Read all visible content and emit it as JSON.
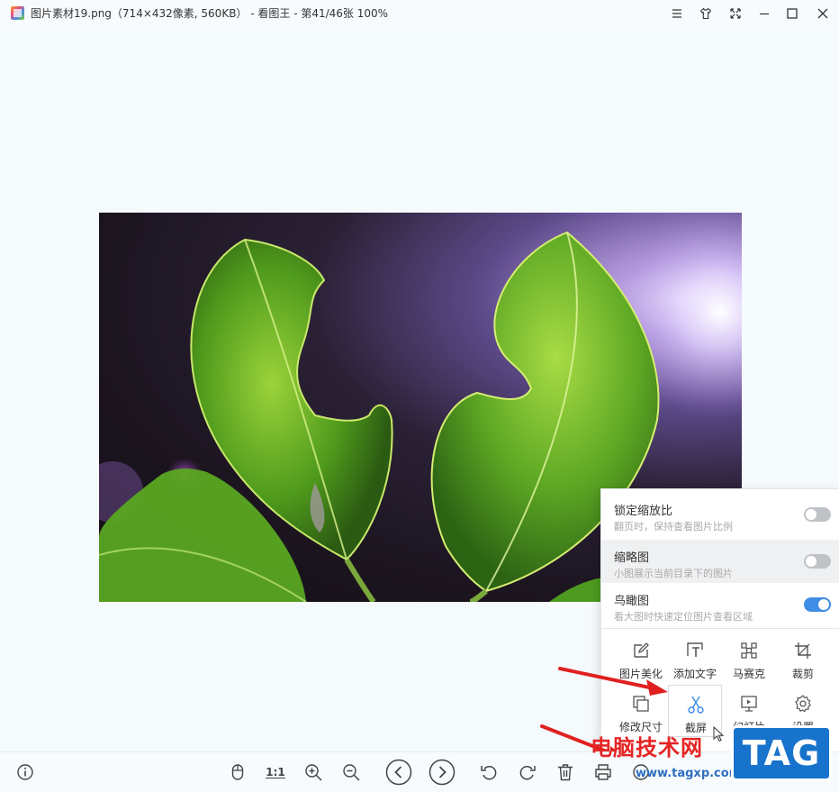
{
  "window": {
    "title": "图片素材19.png（714×432像素, 560KB） - 看图王 - 第41/46张 100%",
    "controls": [
      "menu-icon",
      "skin-icon",
      "fullscreen-icon",
      "minimize-icon",
      "maximize-icon",
      "close-icon"
    ]
  },
  "image": {
    "description_icon": "leaf-photo"
  },
  "settings_panel": {
    "options": [
      {
        "title": "锁定缩放比",
        "desc": "翻页时，保持查看图片比例",
        "enabled": false
      },
      {
        "title": "缩略图",
        "desc": "小图展示当前目录下的图片",
        "enabled": false
      },
      {
        "title": "鸟瞰图",
        "desc": "看大图时快速定位图片查看区域",
        "enabled": true
      }
    ],
    "tools": [
      {
        "label": "图片美化",
        "icon": "edit-icon"
      },
      {
        "label": "添加文字",
        "icon": "add-text-icon"
      },
      {
        "label": "马赛克",
        "icon": "mosaic-icon"
      },
      {
        "label": "裁剪",
        "icon": "crop-icon"
      },
      {
        "label": "修改尺寸",
        "icon": "resize-icon"
      },
      {
        "label": "截屏",
        "icon": "scissors-icon"
      },
      {
        "label": "幻灯片",
        "icon": "slideshow-icon"
      },
      {
        "label": "设置",
        "icon": "gear-icon"
      }
    ]
  },
  "bottom_toolbar": {
    "one_to_one": "1:1",
    "buttons": [
      "info-icon",
      "mouse-icon",
      "zoom-in-icon",
      "zoom-out-icon",
      "previous-icon",
      "next-icon",
      "rotate-left-icon",
      "rotate-right-icon",
      "delete-icon",
      "print-icon",
      "more-icon"
    ]
  },
  "watermark": {
    "text": "电脑技术网",
    "url": "www.tagxp.com",
    "tag": "TAG"
  },
  "colors": {
    "accent": "#3f8de5",
    "annotation_arrow": "#e02020",
    "watermark_red": "#e52424",
    "tag_blue": "#1873cc"
  }
}
